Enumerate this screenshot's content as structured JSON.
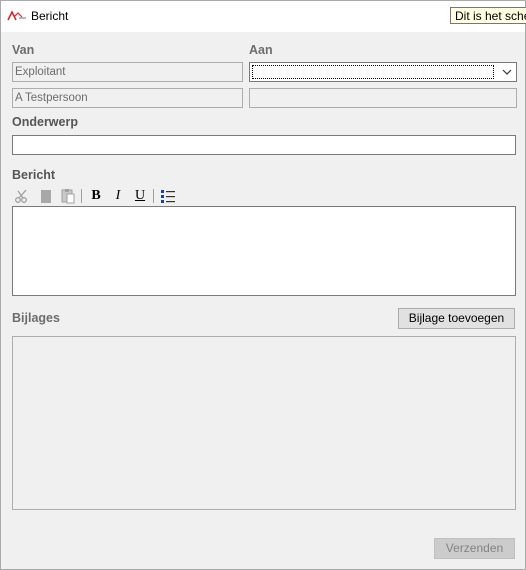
{
  "window": {
    "title": "Bericht",
    "tooltip": "Dit is het sche",
    "icon": "app-logo-icon"
  },
  "labels": {
    "van": "Van",
    "aan": "Aan",
    "onderwerp": "Onderwerp",
    "bericht": "Bericht",
    "bijlages": "Bijlages"
  },
  "van": {
    "account": "Exploitant",
    "name": "A Testpersoon"
  },
  "aan": {
    "selected": "",
    "name": ""
  },
  "onderwerp": {
    "value": ""
  },
  "editor": {
    "toolbar": [
      {
        "name": "cut-icon"
      },
      {
        "name": "copy-icon"
      },
      {
        "name": "paste-icon"
      },
      {
        "name": "bold-button",
        "glyph": "B"
      },
      {
        "name": "italic-button",
        "glyph": "I"
      },
      {
        "name": "underline-button",
        "glyph": "U"
      },
      {
        "name": "bulleted-list-icon"
      }
    ],
    "content": ""
  },
  "buttons": {
    "add_attachment": "Bijlage toevoegen",
    "send": "Verzenden"
  }
}
